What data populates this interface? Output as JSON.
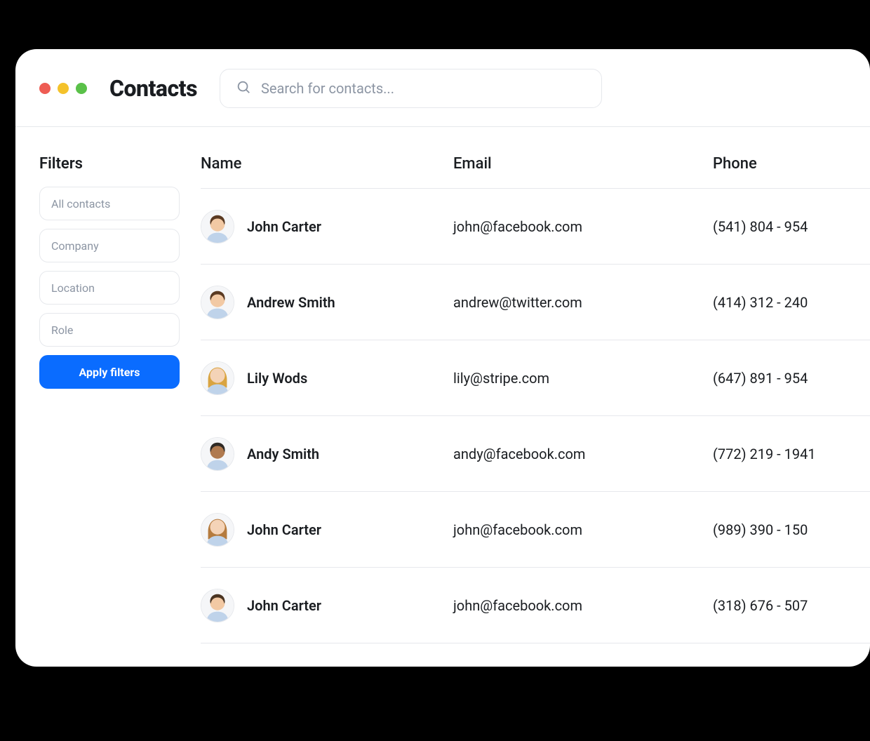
{
  "header": {
    "title": "Contacts",
    "search_placeholder": "Search for contacts..."
  },
  "filters": {
    "title": "Filters",
    "items": [
      "All contacts",
      "Company",
      "Location",
      "Role"
    ],
    "apply_label": "Apply filters"
  },
  "table": {
    "columns": {
      "name": "Name",
      "email": "Email",
      "phone": "Phone"
    },
    "rows": [
      {
        "name": "John Carter",
        "email": "john@facebook.com",
        "phone": "(541) 804 - 954",
        "avatar": "m1"
      },
      {
        "name": "Andrew Smith",
        "email": "andrew@twitter.com",
        "phone": "(414) 312 - 240",
        "avatar": "m1"
      },
      {
        "name": "Lily Wods",
        "email": "lily@stripe.com",
        "phone": "(647) 891 - 954",
        "avatar": "f1"
      },
      {
        "name": "Andy Smith",
        "email": "andy@facebook.com",
        "phone": "(772) 219 - 1941",
        "avatar": "m2"
      },
      {
        "name": "John Carter",
        "email": "john@facebook.com",
        "phone": "(989) 390 - 150",
        "avatar": "f2"
      },
      {
        "name": "John Carter",
        "email": "john@facebook.com",
        "phone": "(318) 676 - 507",
        "avatar": "m3"
      }
    ]
  }
}
